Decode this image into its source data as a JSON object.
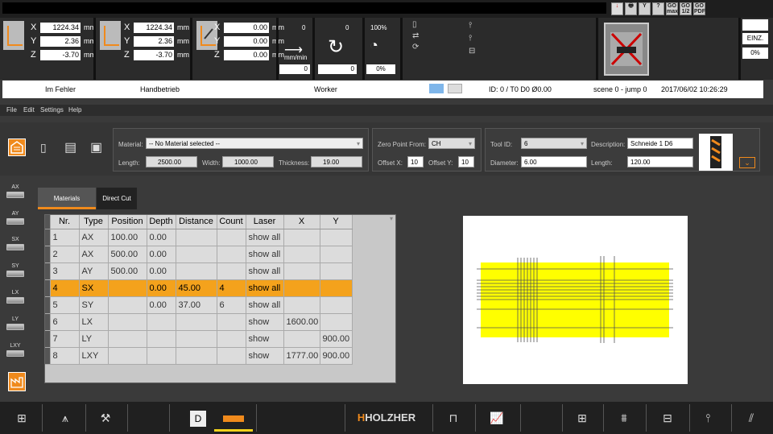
{
  "topbar": {
    "buttons": [
      "↓",
      "🖶",
      "Y",
      "?",
      "GO max",
      "GO 1/2",
      "GO PDF"
    ]
  },
  "axes": {
    "panels": [
      {
        "rows": [
          {
            "axis": "X",
            "value": "1224.34",
            "unit": "mm"
          },
          {
            "axis": "Y",
            "value": "2.36",
            "unit": "mm"
          },
          {
            "axis": "Z",
            "value": "-3.70",
            "unit": "mm"
          }
        ]
      },
      {
        "rows": [
          {
            "axis": "X",
            "value": "1224.34",
            "unit": "mm"
          },
          {
            "axis": "Y",
            "value": "2.36",
            "unit": "mm"
          },
          {
            "axis": "Z",
            "value": "-3.70",
            "unit": "mm"
          }
        ]
      },
      {
        "rows": [
          {
            "axis": "X",
            "value": "0.00",
            "unit": "mm"
          },
          {
            "axis": "Y",
            "value": "0.00",
            "unit": "mm"
          },
          {
            "axis": "Z",
            "value": "0.00",
            "unit": "mm"
          }
        ]
      }
    ]
  },
  "feed": {
    "top": "0",
    "unit": "mm/min",
    "value": "0"
  },
  "spindle": {
    "top": "0",
    "value": "0"
  },
  "override": {
    "top": "100%",
    "value": "0%"
  },
  "mode": {
    "einz": "EINZ.",
    "percent": "0%"
  },
  "status": {
    "state": "Im Fehler",
    "mode": "Handbetrieb",
    "worker": "Worker",
    "id": "ID: 0 /  T0 D0 Ø0.00",
    "scene": "scene 0 - jump 0",
    "datetime": "2017/06/02 10:26:29"
  },
  "menu": [
    "File",
    "Edit",
    "Settings",
    "Help"
  ],
  "material": {
    "label": "Material:",
    "value": "-- No Material selected --",
    "length_label": "Length:",
    "length": "2500.00",
    "width_label": "Width:",
    "width": "1000.00",
    "thickness_label": "Thickness:",
    "thickness": "19.00"
  },
  "zero": {
    "label": "Zero Point From:",
    "value": "CH",
    "offx_label": "Offset X:",
    "offx": "10",
    "offy_label": "Offset Y:",
    "offy": "10"
  },
  "tool": {
    "id_label": "Tool ID:",
    "id": "6",
    "desc_label": "Description:",
    "desc": "Schneide 1 D6",
    "dia_label": "Diameter:",
    "dia": "6.00",
    "len_label": "Length:",
    "len": "120.00"
  },
  "sidebar": [
    "AX",
    "AY",
    "SX",
    "SY",
    "LX",
    "LY",
    "LXY"
  ],
  "tabs": {
    "materials": "Materials",
    "direct": "Direct Cut"
  },
  "table": {
    "headers": [
      "Nr.",
      "Type",
      "Position",
      "Depth",
      "Distance",
      "Count",
      "Laser",
      "X",
      "Y"
    ],
    "rows": [
      [
        "1",
        "AX",
        "100.00",
        "0.00",
        "",
        "",
        "show all",
        "",
        ""
      ],
      [
        "2",
        "AX",
        "500.00",
        "0.00",
        "",
        "",
        "show all",
        "",
        ""
      ],
      [
        "3",
        "AY",
        "500.00",
        "0.00",
        "",
        "",
        "show all",
        "",
        ""
      ],
      [
        "4",
        "SX",
        "",
        "0.00",
        "45.00",
        "4",
        "show all",
        "",
        ""
      ],
      [
        "5",
        "SY",
        "",
        "0.00",
        "37.00",
        "6",
        "show all",
        "",
        ""
      ],
      [
        "6",
        "LX",
        "",
        "",
        "",
        "",
        "show",
        "1600.00",
        ""
      ],
      [
        "7",
        "LY",
        "",
        "",
        "",
        "",
        "show",
        "",
        "900.00"
      ],
      [
        "8",
        "LXY",
        "",
        "",
        "",
        "",
        "show",
        "1777.00",
        "900.00"
      ]
    ],
    "selected_index": 3
  },
  "brand": "HOLZHER",
  "colors": {
    "accent": "#f4a21c",
    "highlight": "#f08a1c",
    "board": "#ffff00"
  }
}
